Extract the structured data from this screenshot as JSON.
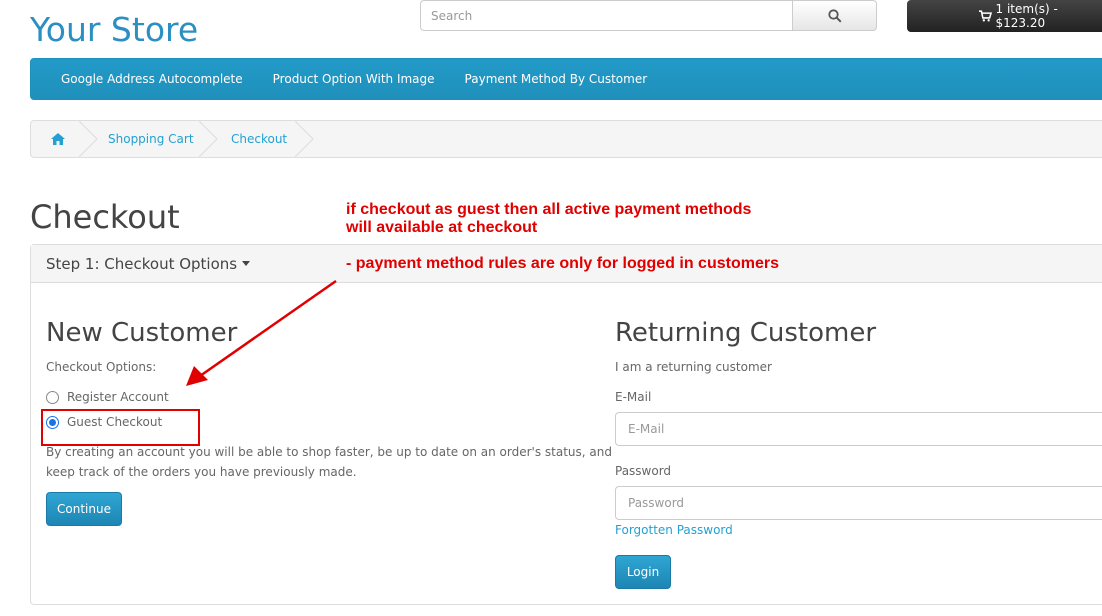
{
  "header": {
    "logo": "Your Store",
    "search_placeholder": "Search",
    "cart_label": "1 item(s) - $123.20"
  },
  "menu": {
    "items": [
      "Google Address Autocomplete",
      "Product Option With Image",
      "Payment Method By Customer"
    ]
  },
  "breadcrumb": {
    "items": [
      "Shopping Cart",
      "Checkout"
    ]
  },
  "page": {
    "title": "Checkout"
  },
  "annotations": {
    "line1": "if checkout as guest then all active payment methods",
    "line2": "will available at checkout",
    "line3": "- payment method rules are only for logged in customers"
  },
  "step": {
    "label": "Step 1: Checkout Options"
  },
  "new_customer": {
    "heading": "New Customer",
    "options_label": "Checkout Options:",
    "register_label": "Register Account",
    "guest_label": "Guest Checkout",
    "description_line1": "By creating an account you will be able to shop faster, be up to date on an order's status, and",
    "description_line2": "keep track of the orders you have previously made.",
    "continue_label": "Continue"
  },
  "returning_customer": {
    "heading": "Returning Customer",
    "subtitle": "I am a returning customer",
    "email_label": "E-Mail",
    "email_placeholder": "E-Mail",
    "password_label": "Password",
    "password_placeholder": "Password",
    "forgot_link": "Forgotten Password",
    "login_label": "Login"
  },
  "colors": {
    "brand_blue": "#229ac8",
    "annotation_red": "#e00000"
  }
}
